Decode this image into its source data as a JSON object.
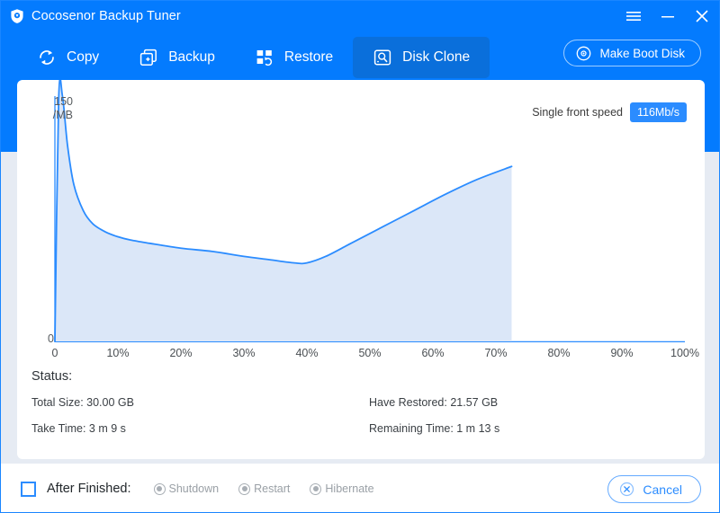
{
  "window": {
    "title": "Cocosenor Backup Tuner",
    "logo_icon": "shield-icon",
    "controls": [
      {
        "name": "menu-button",
        "icon": "hamburger-icon"
      },
      {
        "name": "minimize-button",
        "icon": "minimize-icon"
      },
      {
        "name": "close-button",
        "icon": "close-icon"
      }
    ]
  },
  "nav": {
    "items": [
      {
        "label": "Copy",
        "icon": "refresh-circle-icon",
        "active": false
      },
      {
        "label": "Backup",
        "icon": "square-plus-icon",
        "active": false
      },
      {
        "label": "Restore",
        "icon": "restore-grid-icon",
        "active": false
      },
      {
        "label": "Disk Clone",
        "icon": "disk-clone-icon",
        "active": true
      }
    ],
    "boot_button": {
      "label": "Make Boot Disk",
      "icon": "disc-icon"
    }
  },
  "chart_data": {
    "type": "area",
    "title": "",
    "xlabel": "",
    "ylabel": "150 /MB",
    "y_axis_top_label": "150",
    "y_axis_unit_label": "/MB",
    "y_axis_zero_label": "0",
    "ylim": [
      0,
      150
    ],
    "xlim": [
      0,
      100
    ],
    "grid": false,
    "legend": "none",
    "tick_labels": [
      "0",
      "10%",
      "20%",
      "30%",
      "40%",
      "50%",
      "60%",
      "70%",
      "80%",
      "90%",
      "100%"
    ],
    "x": [
      0,
      0.6,
      1.2,
      2,
      3,
      4.5,
      6,
      8,
      10,
      12,
      15,
      20,
      25,
      30,
      34,
      38,
      40,
      43,
      47,
      52,
      57,
      62,
      67,
      72.5
    ],
    "values": [
      0,
      148,
      150,
      120,
      96,
      80,
      72,
      67,
      64,
      62,
      60,
      57,
      55,
      52,
      50,
      48,
      48,
      52,
      60,
      70,
      80,
      90,
      99,
      107
    ],
    "progress_percent": 72.5,
    "series_color": "#2b8cff",
    "fill_color": "#dbe7f8",
    "speed": {
      "label": "Single front speed",
      "value": "116Mb/s"
    }
  },
  "status": {
    "title": "Status:",
    "rows": [
      {
        "left": "Total Size: 30.00 GB",
        "right": "Have Restored: 21.57 GB"
      },
      {
        "left": "Take Time: 3 m 9 s",
        "right": "Remaining Time: 1 m 13 s"
      }
    ]
  },
  "footer": {
    "after_finished_label": "After Finished:",
    "checkbox_checked": false,
    "options": [
      {
        "label": "Shutdown",
        "selected": false,
        "disabled": true
      },
      {
        "label": "Restart",
        "selected": false,
        "disabled": true
      },
      {
        "label": "Hibernate",
        "selected": false,
        "disabled": true
      }
    ],
    "cancel_label": "Cancel",
    "cancel_icon": "close-circle-icon"
  },
  "colors": {
    "brand_blue": "#047bfe",
    "active_tab": "#0a6fdb",
    "accent": "#2b8cff",
    "body_bg": "#e6ebf3"
  }
}
